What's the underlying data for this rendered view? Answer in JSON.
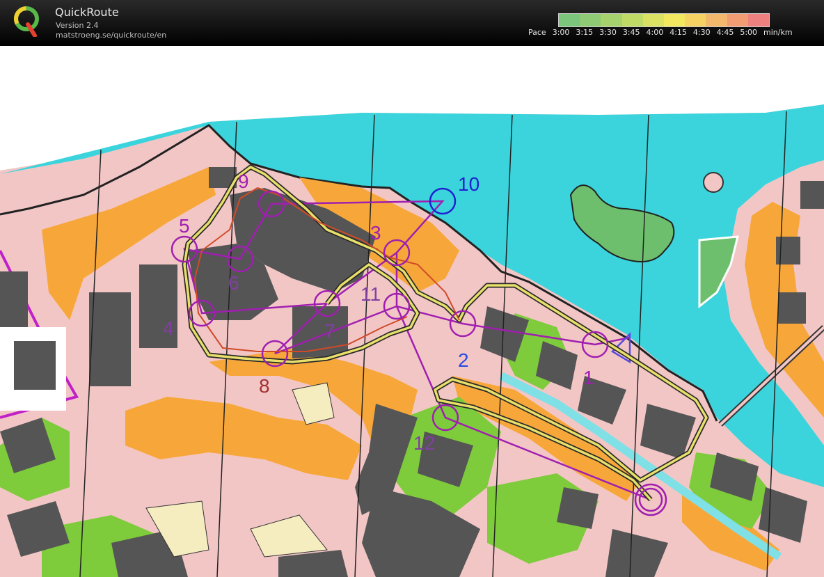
{
  "app": {
    "title": "QuickRoute",
    "version": "Version 2.4",
    "url": "matstroeng.se/quickroute/en"
  },
  "pace": {
    "label": "Pace",
    "ticks": [
      "3:00",
      "3:15",
      "3:30",
      "3:45",
      "4:00",
      "4:15",
      "4:30",
      "4:45",
      "5:00"
    ],
    "unit": "min/km",
    "colors": [
      "#7cc57c",
      "#8fcb74",
      "#a5d26c",
      "#bfdb66",
      "#d9e262",
      "#f1e85f",
      "#f6d262",
      "#f4b86c",
      "#f29c74",
      "#ee8080"
    ]
  },
  "map": {
    "controls": [
      "1",
      "2",
      "3",
      "4",
      "5",
      "6",
      "7",
      "8",
      "9",
      "10",
      "11",
      "12"
    ],
    "colors": {
      "water": "#3bd4dc",
      "land": "#f3c6c6",
      "building": "#555555",
      "open": "#f7a73a",
      "green": "#7ecb3c",
      "course": "#a01fb0"
    }
  }
}
